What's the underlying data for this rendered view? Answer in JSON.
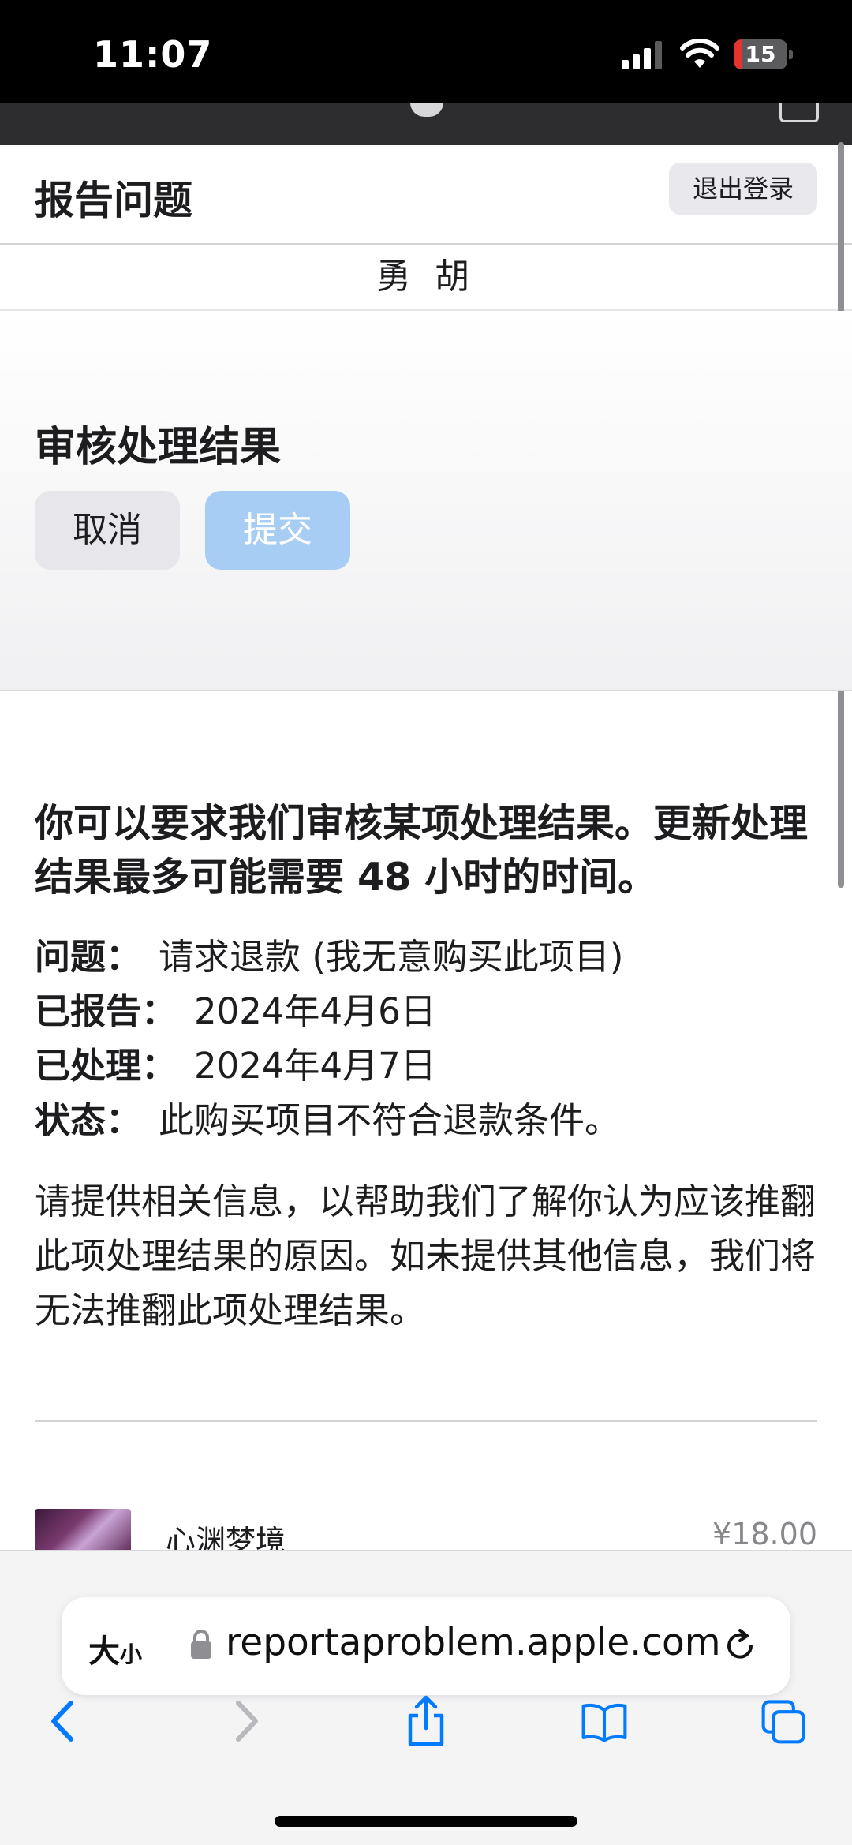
{
  "status_bar": {
    "time": "11:07",
    "battery_percent": "15"
  },
  "header": {
    "title": "报告问题",
    "sign_out_label": "退出登录"
  },
  "user": {
    "name": "勇 胡"
  },
  "review": {
    "title": "审核处理结果",
    "cancel_label": "取消",
    "submit_label": "提交"
  },
  "content": {
    "intro": "你可以要求我们审核某项处理结果。更新处理结果最多可能需要 48 小时的时间。",
    "details": [
      {
        "label": "问题：",
        "value": "请求退款 (我无意购买此项目)"
      },
      {
        "label": "已报告：",
        "value": "2024年4月6日"
      },
      {
        "label": "已处理：",
        "value": "2024年4月7日"
      },
      {
        "label": "状态：",
        "value": "此购买项目不符合退款条件。"
      }
    ],
    "prompt": "请提供相关信息，以帮助我们了解你认为应该推翻此项处理结果的原因。如未提供其他信息，我们将无法推翻此项处理结果。"
  },
  "item": {
    "name": "心渊梦境",
    "price": "¥18.00"
  },
  "browser": {
    "text_size_label": "大",
    "text_size_small": "小",
    "url": "reportaproblem.apple.com"
  },
  "icons": {
    "status": [
      "signal-icon",
      "wifi-icon",
      "battery-icon"
    ],
    "toolbar": [
      "back-icon",
      "forward-icon",
      "share-icon",
      "bookmarks-icon",
      "tabs-icon"
    ]
  },
  "colors": {
    "accent": "#007aff",
    "submit_disabled": "#a8cdf5",
    "battery_low": "#e5332e"
  }
}
